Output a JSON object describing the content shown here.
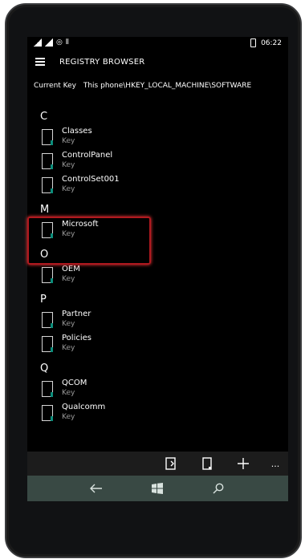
{
  "status": {
    "time": "06:22"
  },
  "header": {
    "title": "REGISTRY BROWSER"
  },
  "current_key": {
    "label": "Current Key",
    "value": "This phone\\HKEY_LOCAL_MACHINE\\SOFTWARE"
  },
  "sections": [
    {
      "letter": "C",
      "items": [
        {
          "name": "Classes",
          "type": "Key"
        },
        {
          "name": "ControlPanel",
          "type": "Key"
        },
        {
          "name": "ControlSet001",
          "type": "Key"
        }
      ]
    },
    {
      "letter": "M",
      "items": [
        {
          "name": "Microsoft",
          "type": "Key"
        }
      ]
    },
    {
      "letter": "O",
      "items": [
        {
          "name": "OEM",
          "type": "Key"
        }
      ]
    },
    {
      "letter": "P",
      "items": [
        {
          "name": "Partner",
          "type": "Key"
        },
        {
          "name": "Policies",
          "type": "Key"
        }
      ]
    },
    {
      "letter": "Q",
      "items": [
        {
          "name": "QCOM",
          "type": "Key"
        },
        {
          "name": "Qualcomm",
          "type": "Key"
        }
      ]
    }
  ],
  "app_bar": {
    "more_label": "..."
  },
  "icons": {
    "back": "back-arrow-icon",
    "start": "windows-start-icon",
    "search": "search-icon",
    "new_value": "new-value-icon",
    "new_key": "new-key-icon",
    "add": "add-icon"
  }
}
